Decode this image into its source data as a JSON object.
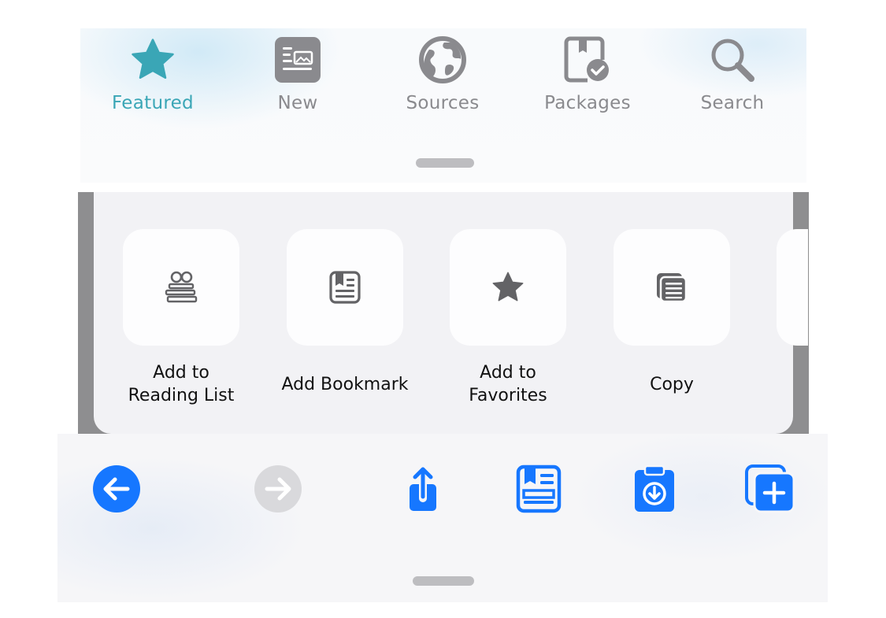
{
  "tabbar": {
    "active_color": "#3aa6b6",
    "inactive_color": "#8a8a8e",
    "tabs": [
      {
        "label": "Featured",
        "icon": "star-icon",
        "active": true
      },
      {
        "label": "New",
        "icon": "newspaper-icon",
        "active": false
      },
      {
        "label": "Sources",
        "icon": "globe-icon",
        "active": false
      },
      {
        "label": "Packages",
        "icon": "package-check-icon",
        "active": false
      },
      {
        "label": "Search",
        "icon": "magnifier-icon",
        "active": false
      }
    ]
  },
  "share_sheet": {
    "actions": [
      {
        "line1": "Add to",
        "line2": "Reading List",
        "icon": "reading-glasses-books-icon"
      },
      {
        "line1": "Add Bookmark",
        "line2": "",
        "icon": "bookmark-book-icon"
      },
      {
        "line1": "Add to",
        "line2": "Favorites",
        "icon": "star-icon"
      },
      {
        "line1": "Copy",
        "line2": "",
        "icon": "copy-doc-icon"
      }
    ]
  },
  "toolbar": {
    "accent_color": "#1677ff",
    "disabled_color": "#d9d9dc",
    "items": [
      {
        "name": "back",
        "icon": "arrow-left-circle-icon",
        "enabled": true
      },
      {
        "name": "forward",
        "icon": "arrow-right-circle-icon",
        "enabled": false
      },
      {
        "name": "share",
        "icon": "share-up-arrow-icon",
        "enabled": true
      },
      {
        "name": "reader",
        "icon": "reader-bookmark-icon",
        "enabled": true
      },
      {
        "name": "download",
        "icon": "clipboard-download-icon",
        "enabled": true
      },
      {
        "name": "new-tab",
        "icon": "add-tab-icon",
        "enabled": true
      }
    ]
  }
}
